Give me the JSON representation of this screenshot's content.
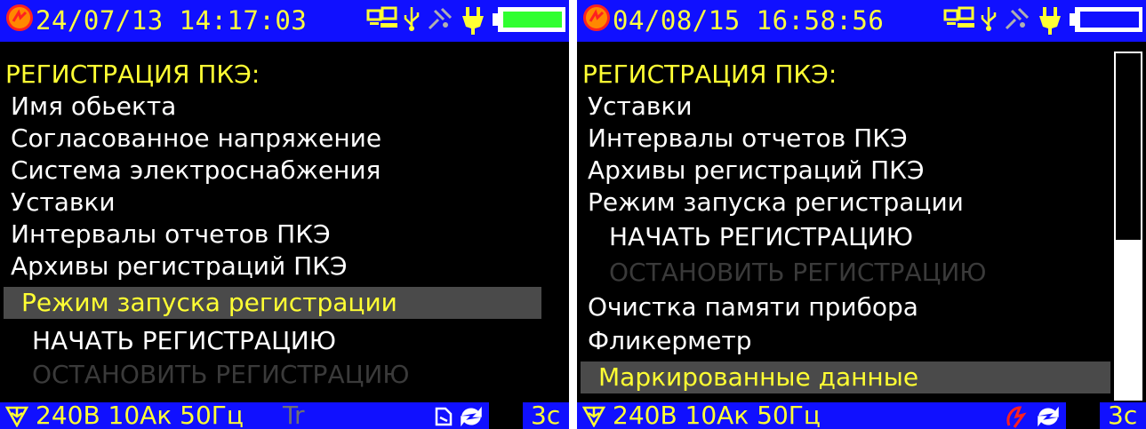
{
  "colors": {
    "bar_bg": "#1010ff",
    "screen_bg": "#000000",
    "title_yellow": "#ffff33",
    "item_white": "#ffffff",
    "disabled_gray": "#3a3a3a",
    "highlight_bg": "#4a4a4a",
    "logo_orange": "#ff8800",
    "battery_green": "#30ff30"
  },
  "screens": [
    {
      "status_bar": {
        "datetime": "24/07/13 14:17:03",
        "icons": [
          "logo-icon",
          "pc-connection-icon",
          "usb-icon",
          "satellite-icon",
          "power-plug-icon",
          "battery-icon"
        ],
        "battery_level": 1.0
      },
      "menu": {
        "title": "РЕГИСТРАЦИЯ ПКЭ:",
        "items": [
          {
            "label": "Имя обьекта",
            "state": "normal"
          },
          {
            "label": "Согласованное напряжение",
            "state": "normal"
          },
          {
            "label": "Система электроснабжения",
            "state": "normal"
          },
          {
            "label": "Уставки",
            "state": "normal"
          },
          {
            "label": "Интервалы отчетов ПКЭ",
            "state": "normal"
          },
          {
            "label": "Архивы регистраций ПКЭ",
            "state": "normal"
          },
          {
            "label": "Режим запуска регистрации",
            "state": "selected"
          },
          {
            "label": "НАЧАТЬ РЕГИСТРАЦИЮ",
            "state": "sub"
          },
          {
            "label": "ОСТАНОВИТЬ РЕГИСТРАЦИЮ",
            "state": "disabled"
          }
        ]
      },
      "bottom_bar": {
        "params": "240В 10Ак 50Гц",
        "tr_label": "Tr",
        "right_label": "3с",
        "icons": [
          "triangle-connection-icon",
          "printer-icon",
          "refresh-icon"
        ]
      }
    },
    {
      "status_bar": {
        "datetime": "04/08/15 16:58:56",
        "icons": [
          "logo-icon",
          "pc-connection-icon",
          "usb-icon",
          "satellite-icon",
          "power-plug-icon",
          "battery-icon"
        ],
        "battery_level": 0.0
      },
      "menu": {
        "title": "РЕГИСТРАЦИЯ ПКЭ:",
        "items": [
          {
            "label": "Уставки",
            "state": "normal"
          },
          {
            "label": "Интервалы отчетов ПКЭ",
            "state": "normal"
          },
          {
            "label": "Архивы регистраций ПКЭ",
            "state": "normal"
          },
          {
            "label": "Режим запуска регистрации",
            "state": "normal"
          },
          {
            "label": "НАЧАТЬ РЕГИСТРАЦИЮ",
            "state": "sub"
          },
          {
            "label": "ОСТАНОВИТЬ РЕГИСТРАЦИЮ",
            "state": "disabled"
          },
          {
            "label": "Очистка памяти прибора",
            "state": "normal"
          },
          {
            "label": "Фликерметр",
            "state": "normal"
          },
          {
            "label": "Маркированные данные",
            "state": "selected"
          }
        ],
        "scroll_position": 0.55
      },
      "bottom_bar": {
        "params": "240В 10Ак 50Гц",
        "right_label": "3с",
        "icons": [
          "triangle-connection-icon",
          "recording-flash-icon",
          "refresh-icon"
        ]
      }
    }
  ]
}
